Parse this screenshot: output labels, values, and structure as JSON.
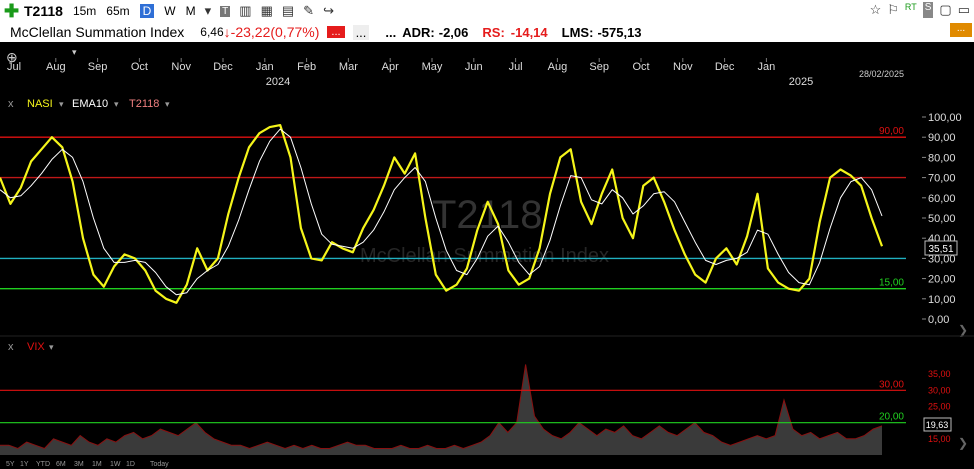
{
  "toolbar": {
    "add_icon": "plus-icon",
    "symbol": "T2118",
    "timeframes": [
      "15m",
      "65m",
      "D",
      "W",
      "M"
    ],
    "selected_timeframe": "D",
    "icons": [
      "chevron-down-icon",
      "text-icon",
      "chart-type-icon",
      "calendar-icon",
      "table-icon",
      "brush-icon",
      "share-icon"
    ],
    "right_icons": [
      "star-icon",
      "flag-icon",
      "rt-icon",
      "sc-icon",
      "window-icon",
      "minimize-icon"
    ],
    "rt_label": "RT",
    "sc_label": "S"
  },
  "info": {
    "name": "McClellan Summation Index",
    "last": "6,46",
    "change": "-23,22",
    "change_pct": "(0,77%)",
    "dots1": "...",
    "dots2": "...",
    "dots3": "...",
    "adr_label": "ADR:",
    "adr_value": "-2,06",
    "rs_label": "RS:",
    "rs_value": "-14,14",
    "lms_label": "LMS:",
    "lms_value": "-575,13",
    "menu_button": "..."
  },
  "time_axis": {
    "months": [
      "Jul",
      "Aug",
      "Sep",
      "Oct",
      "Nov",
      "Dec",
      "Jan",
      "Feb",
      "Mar",
      "Apr",
      "May",
      "Jun",
      "Jul",
      "Aug",
      "Sep",
      "Oct",
      "Nov",
      "Dec",
      "Jan"
    ],
    "years": [
      "2024",
      "2025"
    ],
    "last_date": "28/02/2025",
    "period_buttons": [
      "5Y",
      "1Y",
      "YTD",
      "6M",
      "3M",
      "1M",
      "1W",
      "1D",
      "Today"
    ]
  },
  "colors": {
    "background": "#000000",
    "nasi": "#f5f51a",
    "ema": "#ffffff",
    "level_90": "#e01010",
    "level_70": "#c01818",
    "level_30": "#20b0c0",
    "level_15": "#20d020",
    "vix_fill": "#3a3a3a"
  },
  "chart_data": [
    {
      "type": "line",
      "legend": [
        "NASI",
        "EMA10",
        "T2118"
      ],
      "close_icon": "x",
      "watermark": "T2118",
      "watermark_sub": "McClellan Summation Index",
      "ylim": [
        0,
        100
      ],
      "y_ticks": [
        "100,00",
        "90,00",
        "80,00",
        "70,00",
        "60,00",
        "50,00",
        "40,00",
        "30,00",
        "20,00",
        "10,00",
        "0,00"
      ],
      "reference_lines": [
        {
          "value": 90,
          "label": "90,00"
        },
        {
          "value": 70,
          "label": ""
        },
        {
          "value": 30,
          "label": ""
        },
        {
          "value": 15,
          "label": "15,00"
        }
      ],
      "last_value": "35,51",
      "series": [
        {
          "name": "NASI",
          "values": [
            70,
            57,
            65,
            78,
            84,
            90,
            85,
            68,
            40,
            22,
            16,
            26,
            32,
            30,
            24,
            14,
            10,
            8,
            17,
            35,
            24,
            30,
            52,
            70,
            85,
            92,
            95,
            96,
            80,
            45,
            30,
            29,
            38,
            35,
            33,
            45,
            54,
            66,
            80,
            72,
            82,
            50,
            22,
            14,
            17,
            25,
            44,
            58,
            47,
            24,
            17,
            20,
            35,
            62,
            80,
            84,
            58,
            47,
            62,
            74,
            50,
            40,
            66,
            70,
            58,
            44,
            32,
            22,
            18,
            30,
            35,
            27,
            41,
            62,
            25,
            18,
            15,
            14,
            20,
            48,
            70,
            74,
            71,
            66,
            50,
            36
          ]
        },
        {
          "name": "EMA10",
          "values": [
            64,
            60,
            61,
            66,
            72,
            79,
            84,
            80,
            68,
            50,
            35,
            28,
            28,
            29,
            28,
            23,
            16,
            12,
            13,
            20,
            24,
            27,
            36,
            49,
            64,
            78,
            88,
            94,
            90,
            75,
            57,
            42,
            37,
            36,
            35,
            38,
            44,
            53,
            64,
            70,
            75,
            68,
            50,
            34,
            24,
            22,
            30,
            41,
            46,
            38,
            28,
            22,
            26,
            39,
            56,
            71,
            70,
            59,
            57,
            64,
            60,
            52,
            56,
            62,
            63,
            58,
            48,
            38,
            29,
            27,
            29,
            30,
            33,
            44,
            42,
            32,
            23,
            18,
            17,
            28,
            45,
            60,
            68,
            70,
            64,
            51
          ]
        }
      ]
    },
    {
      "type": "area",
      "legend": [
        "VIX"
      ],
      "close_icon": "x",
      "y_ticks": [
        "35,00",
        "30,00",
        "25,00",
        "20,00",
        "15,00"
      ],
      "reference_lines": [
        {
          "value": 30,
          "label": "30,00"
        },
        {
          "value": 20,
          "label": "20,00"
        }
      ],
      "last_value": "19,63",
      "series": [
        {
          "name": "VIX",
          "values": [
            13,
            13,
            12,
            14,
            13,
            12,
            15,
            14,
            13,
            16,
            14,
            13,
            15,
            14,
            16,
            17,
            15,
            16,
            18,
            17,
            16,
            18,
            20,
            17,
            15,
            14,
            13,
            13,
            12,
            13,
            14,
            13,
            12,
            13,
            12,
            13,
            12,
            12,
            13,
            14,
            13,
            13,
            12,
            12,
            12,
            13,
            12,
            12,
            13,
            12,
            12,
            13,
            12,
            13,
            14,
            16,
            20,
            17,
            20,
            38,
            22,
            18,
            16,
            15,
            17,
            20,
            18,
            16,
            18,
            17,
            19,
            16,
            15,
            17,
            19,
            17,
            16,
            18,
            20,
            17,
            16,
            14,
            13,
            14,
            15,
            16,
            15,
            16,
            27,
            18,
            16,
            17,
            15,
            16,
            17,
            15,
            15,
            16,
            18,
            19
          ]
        }
      ]
    }
  ]
}
